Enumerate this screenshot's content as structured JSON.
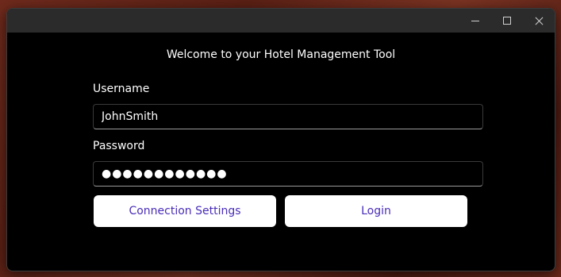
{
  "window": {
    "controls": {
      "minimize_icon": "minimize-icon",
      "maximize_icon": "maximize-icon",
      "close_icon": "close-icon"
    }
  },
  "login": {
    "welcome_text": "Welcome to your Hotel Management Tool",
    "username_label": "Username",
    "username_value": "JohnSmith",
    "password_label": "Password",
    "password_value": "●●●●●●●●●●●●",
    "connection_settings_label": "Connection Settings",
    "login_label": "Login"
  },
  "colors": {
    "window_background": "#000000",
    "titlebar_background": "#2b2b2b",
    "button_background": "#ffffff",
    "button_text": "#4a2db8",
    "text": "#ffffff"
  }
}
